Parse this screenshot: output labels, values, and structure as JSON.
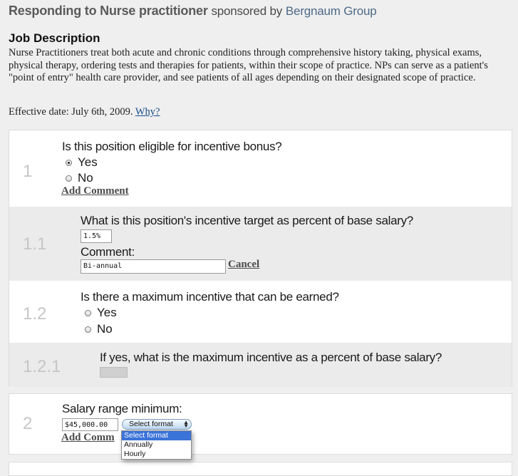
{
  "header": {
    "title": "Responding to Nurse practitioner",
    "sponsored_by": "sponsored by",
    "sponsor": "Bergnaum Group"
  },
  "job": {
    "heading": "Job Description",
    "description": "Nurse Practitioners treat both acute and chronic conditions through comprehensive history taking, physical exams, physical therapy, ordering tests and therapies for patients, within their scope of practice. NPs can serve as a patient's \"point of entry\" health care provider, and see patients of all ages depending on their designated scope of practice.",
    "effective_label": "Effective date: July 6th, 2009.",
    "why_link": "Why?"
  },
  "questions": {
    "q1": {
      "number": "1",
      "text": "Is this position eligible for incentive bonus?",
      "options": [
        "Yes",
        "No"
      ],
      "selected": "Yes",
      "add_comment": "Add Comment"
    },
    "q1_1": {
      "number": "1.1",
      "text": "What is this position's incentive target as percent of base salary?",
      "value": "1.5%",
      "comment_label": "Comment:",
      "comment_value": "Bi-annual",
      "cancel": "Cancel"
    },
    "q1_2": {
      "number": "1.2",
      "text": "Is there a maximum incentive that can be earned?",
      "options": [
        "Yes",
        "No"
      ],
      "selected": null
    },
    "q1_2_1": {
      "number": "1.2.1",
      "text": "If yes, what is the maximum incentive as a percent of base salary?",
      "value": ""
    },
    "q2": {
      "number": "2",
      "text": "Salary range minimum:",
      "value": "$45,000.00",
      "format_selected": "Select format",
      "format_options": [
        "Select format",
        "Annually",
        "Hourly"
      ],
      "add_comment": "Add Comm"
    }
  },
  "colors": {
    "accent_link": "#1a4d8c",
    "sponsor": "#4d6a87",
    "select_highlight": "#3b73d8"
  }
}
